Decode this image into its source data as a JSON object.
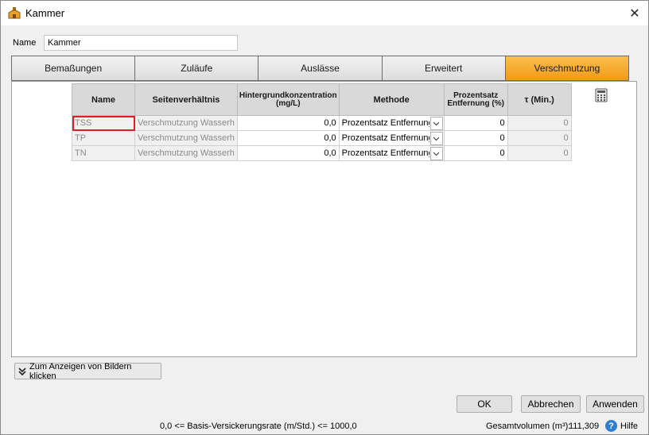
{
  "window": {
    "title": "Kammer",
    "close_glyph": "✕"
  },
  "form": {
    "name_label": "Name",
    "name_value": "Kammer"
  },
  "tabs": [
    {
      "label": "Bemaßungen",
      "active": false
    },
    {
      "label": "Zuläufe",
      "active": false
    },
    {
      "label": "Auslässe",
      "active": false
    },
    {
      "label": "Erweitert",
      "active": false
    },
    {
      "label": "Verschmutzung",
      "active": true
    }
  ],
  "grid": {
    "headers": {
      "name": "Name",
      "seitenverhaeltnis": "Seitenverhältnis",
      "hintergrund": "Hintergrundkonzentration (mg/L)",
      "methode": "Methode",
      "prozentsatz": "Prozentsatz Entfernung (%)",
      "tau": "τ (Min.)"
    },
    "rows": [
      {
        "name": "TSS",
        "seitenverhaeltnis": "Verschmutzung Wasserh",
        "hintergrund": "0,0",
        "methode": "Prozentsatz Entfernung",
        "prozentsatz": "0",
        "tau": "0"
      },
      {
        "name": "TP",
        "seitenverhaeltnis": "Verschmutzung Wasserh",
        "hintergrund": "0,0",
        "methode": "Prozentsatz Entfernung",
        "prozentsatz": "0",
        "tau": "0"
      },
      {
        "name": "TN",
        "seitenverhaeltnis": "Verschmutzung Wasserh",
        "hintergrund": "0,0",
        "methode": "Prozentsatz Entfernung",
        "prozentsatz": "0",
        "tau": "0"
      }
    ]
  },
  "show_images_label": "Zum Anzeigen von Bildern klicken",
  "buttons": {
    "ok": "OK",
    "cancel": "Abbrechen",
    "apply": "Anwenden"
  },
  "status": {
    "range": "0,0 <= Basis-Versickerungsrate (m/Std.) <= 1000,0",
    "total_label": "Gesamtvolumen (m³):",
    "total_value": "111,309",
    "help_label": "Hilfe",
    "help_glyph": "?"
  },
  "icons": {
    "app": "building-icon",
    "calculator": "calculator-icon",
    "dropdown": "chevron-down-icon",
    "expand": "double-chevron-down-icon",
    "help": "help-icon"
  },
  "colors": {
    "active_tab": "#f5a623",
    "selection": "#e02020",
    "help": "#2b7fd6"
  }
}
